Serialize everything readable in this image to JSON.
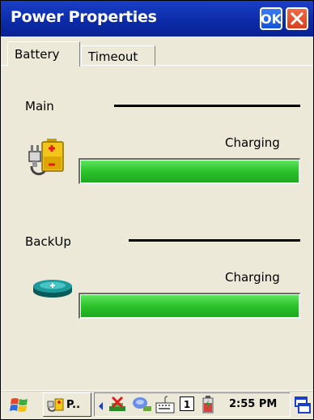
{
  "window": {
    "title": "Power Properties",
    "ok_label": "OK"
  },
  "tabs": [
    {
      "label": "Battery",
      "active": true
    },
    {
      "label": "Timeout",
      "active": false
    }
  ],
  "main": {
    "label": "Main",
    "status": "Charging",
    "level_fraction": 1.0
  },
  "backup": {
    "label": "BackUp",
    "status": "Charging",
    "level_fraction": 1.0
  },
  "taskbar": {
    "task_label": "P..",
    "input_number": "1",
    "clock": "2:55 PM"
  },
  "colors": {
    "titlebar": "#0b2aa6",
    "progress": "#2bc22b",
    "window_bg": "#ece9d8"
  }
}
